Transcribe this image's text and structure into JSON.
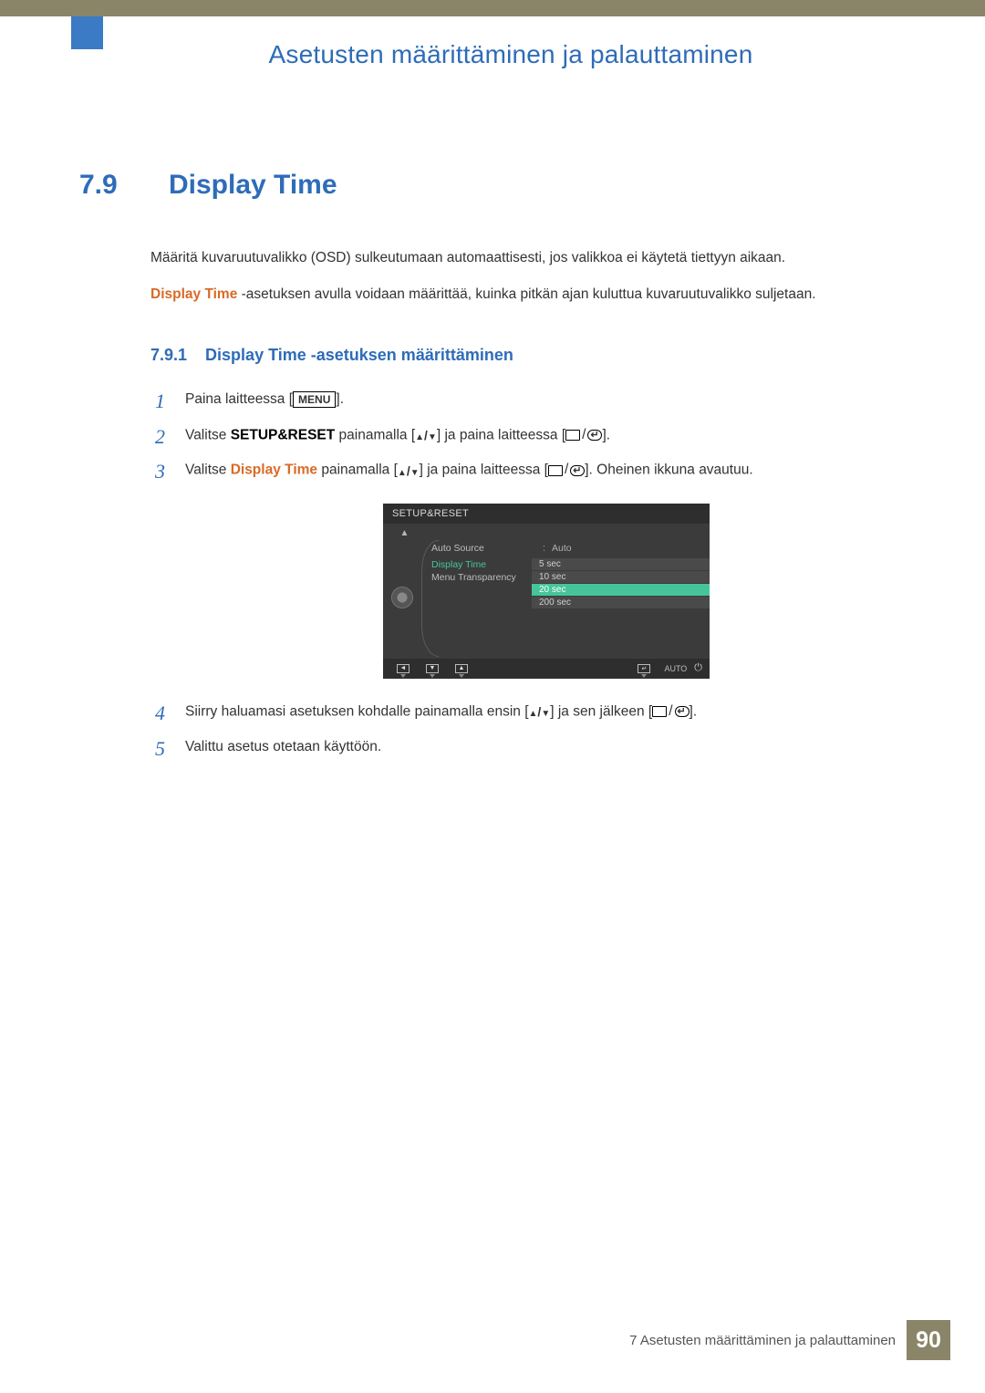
{
  "chapter_title": "Asetusten määrittäminen ja palauttaminen",
  "section": {
    "num": "7.9",
    "title": "Display Time"
  },
  "intro_para": "Määritä kuvaruutuvalikko (OSD) sulkeutumaan automaattisesti, jos valikkoa ei käytetä tiettyyn aikaan.",
  "desc": {
    "term": "Display Time",
    "rest": " -asetuksen avulla voidaan määrittää, kuinka pitkän ajan kuluttua kuvaruutuvalikko suljetaan."
  },
  "subsection": {
    "num": "7.9.1",
    "title": "Display Time -asetuksen määrittäminen"
  },
  "steps": {
    "s1": {
      "n": "1",
      "pre": "Paina laitteessa [",
      "menu": "MENU",
      "post": "]."
    },
    "s2": {
      "n": "2",
      "a": "Valitse ",
      "term": "SETUP&RESET",
      "b": " painamalla [",
      "c": "] ja paina laitteessa [",
      "d": "]."
    },
    "s3": {
      "n": "3",
      "a": "Valitse ",
      "term": "Display Time",
      "b": " painamalla [",
      "c": "] ja paina laitteessa [",
      "d": "]. Oheinen ikkuna avautuu."
    },
    "s4": {
      "n": "4",
      "a": "Siirry haluamasi asetuksen kohdalle painamalla ensin [",
      "b": "] ja sen jälkeen [",
      "c": "]."
    },
    "s5": {
      "n": "5",
      "a": "Valittu asetus otetaan käyttöön."
    }
  },
  "osd": {
    "header": "SETUP&RESET",
    "rows": {
      "auto_source": {
        "label": "Auto Source",
        "value": "Auto"
      },
      "display_time": {
        "label": "Display Time"
      },
      "menu_transparency": {
        "label": "Menu Transparency"
      }
    },
    "options": [
      "5 sec",
      "10 sec",
      "20 sec",
      "200 sec"
    ],
    "footer_auto": "AUTO"
  },
  "footer": {
    "text": "7 Asetusten määrittäminen ja palauttaminen",
    "page": "90"
  }
}
